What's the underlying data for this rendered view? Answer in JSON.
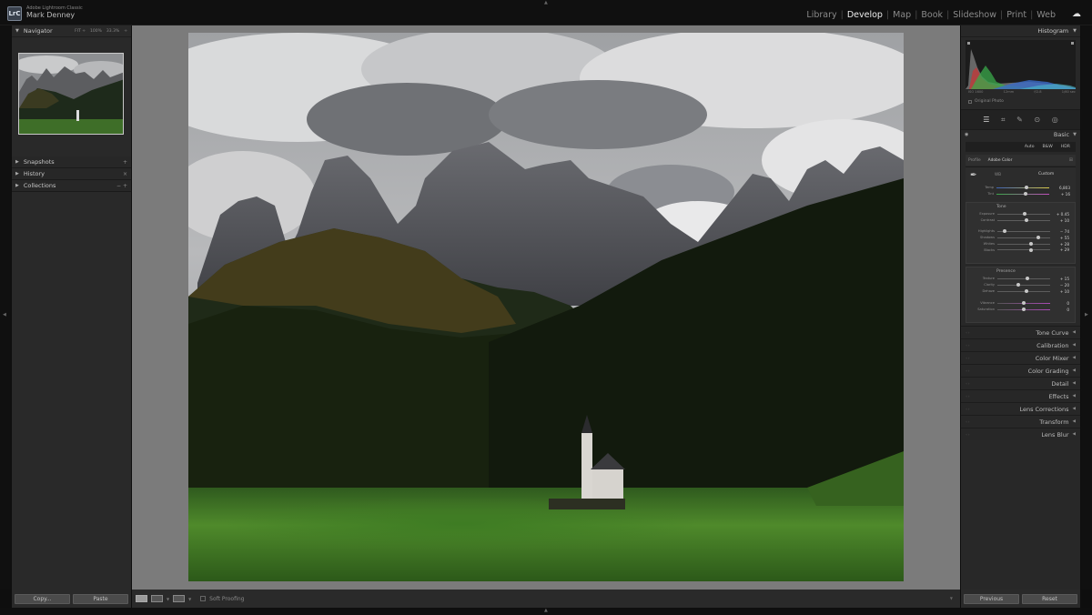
{
  "app": {
    "app_name": "Adobe Lightroom Classic",
    "user_name": "Mark Denney",
    "logo": "LrC"
  },
  "modules": [
    {
      "label": "Library",
      "active": false
    },
    {
      "label": "Develop",
      "active": true
    },
    {
      "label": "Map",
      "active": false
    },
    {
      "label": "Book",
      "active": false
    },
    {
      "label": "Slideshow",
      "active": false
    },
    {
      "label": "Print",
      "active": false
    },
    {
      "label": "Web",
      "active": false
    }
  ],
  "icons": {
    "cloud": "cloud-icon",
    "collapse": "triangle-icon",
    "eye": "eye-icon",
    "eyedropper": "eyedropper-icon"
  },
  "left_panel": {
    "navigator": {
      "title": "Navigator",
      "zoom_options": [
        "FIT ÷",
        "100%",
        "33.3%"
      ]
    },
    "sections": [
      {
        "title": "Snapshots",
        "controls": "+"
      },
      {
        "title": "History",
        "controls": "×"
      },
      {
        "title": "Collections",
        "controls": "− +"
      }
    ],
    "copy_label": "Copy...",
    "paste_label": "Paste"
  },
  "toolbar": {
    "soft_proofing_label": "Soft Proofing"
  },
  "right_panel": {
    "histogram": {
      "title": "Histogram",
      "info": [
        "ISO 1600",
        "12mm",
        "f/2.8",
        "1/60 sec"
      ],
      "original_photo_label": "Original Photo"
    },
    "basic": {
      "title": "Basic",
      "treatment": [
        "Auto",
        "B&W",
        "HDR"
      ],
      "profile_label": "Profile",
      "profile_value": "Adobe Color",
      "wb_label": "WB",
      "wb_value": "Custom",
      "temp": {
        "label": "Temp",
        "value": "6,803",
        "pos": 0.57
      },
      "tint": {
        "label": "Tint",
        "value": "+ 16",
        "pos": 0.55
      },
      "tone_title": "Tone",
      "tone": [
        {
          "label": "Exposure",
          "value": "+ 0.45",
          "pos": 0.52
        },
        {
          "label": "Contrast",
          "value": "+ 10",
          "pos": 0.55
        },
        {
          "label": "Highlights",
          "value": "− 74",
          "pos": 0.13
        },
        {
          "label": "Shadows",
          "value": "+ 55",
          "pos": 0.78
        },
        {
          "label": "Whites",
          "value": "+ 28",
          "pos": 0.64
        },
        {
          "label": "Blacks",
          "value": "+ 29",
          "pos": 0.64
        }
      ],
      "presence_title": "Presence",
      "presence": [
        {
          "label": "Texture",
          "value": "+ 15",
          "pos": 0.57
        },
        {
          "label": "Clarity",
          "value": "− 20",
          "pos": 0.4
        },
        {
          "label": "Dehaze",
          "value": "+ 10",
          "pos": 0.55
        },
        {
          "label": "Vibrance",
          "value": "0",
          "pos": 0.5
        },
        {
          "label": "Saturation",
          "value": "0",
          "pos": 0.5
        }
      ]
    },
    "sections": [
      "Tone Curve",
      "Calibration",
      "Color Mixer",
      "Color Grading",
      "Detail",
      "Effects",
      "Lens Corrections",
      "Transform",
      "Lens Blur"
    ],
    "previous_label": "Previous",
    "reset_label": "Reset"
  }
}
